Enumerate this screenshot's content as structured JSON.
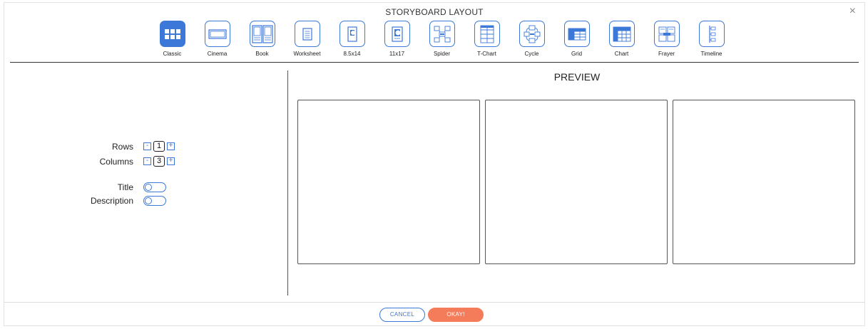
{
  "dialog": {
    "title": "STORYBOARD LAYOUT",
    "close_glyph": "×"
  },
  "layouts": [
    {
      "label": "Classic",
      "icon": "classic-layout-icon"
    },
    {
      "label": "Cinema",
      "icon": "cinema-layout-icon"
    },
    {
      "label": "Book",
      "icon": "book-layout-icon"
    },
    {
      "label": "Worksheet",
      "icon": "worksheet-layout-icon"
    },
    {
      "label": "8.5x14",
      "icon": "legal-page-layout-icon"
    },
    {
      "label": "11x17",
      "icon": "tabloid-page-layout-icon"
    },
    {
      "label": "Spider",
      "icon": "spider-layout-icon"
    },
    {
      "label": "T-Chart",
      "icon": "t-chart-layout-icon"
    },
    {
      "label": "Cycle",
      "icon": "cycle-layout-icon"
    },
    {
      "label": "Grid",
      "icon": "grid-layout-icon"
    },
    {
      "label": "Chart",
      "icon": "chart-layout-icon"
    },
    {
      "label": "Frayer",
      "icon": "frayer-layout-icon"
    },
    {
      "label": "Timeline",
      "icon": "timeline-layout-icon"
    }
  ],
  "selected_layout": "Classic",
  "controls": {
    "rows": {
      "label": "Rows",
      "value": "1",
      "minus": "-",
      "plus": "+"
    },
    "columns": {
      "label": "Columns",
      "value": "3",
      "minus": "-",
      "plus": "+"
    },
    "title": {
      "label": "Title",
      "enabled": false
    },
    "description": {
      "label": "Description",
      "enabled": false
    }
  },
  "preview": {
    "title": "PREVIEW",
    "rows": 1,
    "columns": 3
  },
  "footer": {
    "cancel_label": "CANCEL",
    "okay_label": "OKAY!"
  },
  "colors": {
    "accent": "#3c78d8",
    "okay": "#f47c5a"
  }
}
